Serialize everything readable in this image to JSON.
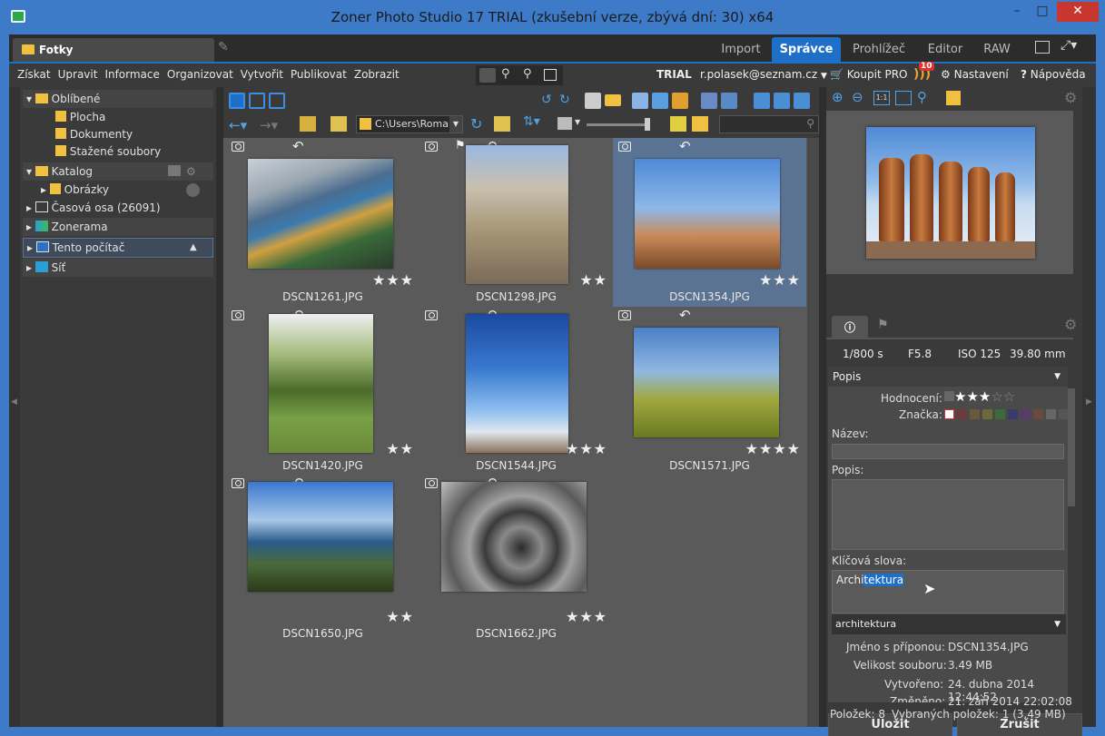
{
  "window": {
    "title": "Zoner Photo Studio 17 TRIAL (zkušební verze, zbývá dní: 30) x64",
    "minimize": "–",
    "maximize": "□",
    "close": "✕"
  },
  "tabs": {
    "left_tab": "Fotky",
    "import": "Import",
    "spravce": "Správce",
    "prohlizec": "Prohlížeč",
    "editor": "Editor",
    "raw": "RAW"
  },
  "menu": {
    "items": [
      "Získat",
      "Upravit",
      "Informace",
      "Organizovat",
      "Vytvořit",
      "Publikovat",
      "Zobrazit"
    ],
    "trial": "TRIAL",
    "email": "r.polasek@seznam.cz",
    "buy": "Koupit PRO",
    "badge": "10",
    "settings": "Nastavení",
    "help": "Nápověda"
  },
  "nav": {
    "path": "C:\\Users\\Roma",
    "search_placeholder": ""
  },
  "tree": {
    "oblibene": "Oblíbené",
    "plocha": "Plocha",
    "dokumenty": "Dokumenty",
    "stazene": "Stažené soubory",
    "katalog": "Katalog",
    "obrazky": "Obrázky",
    "casova_osa": "Časová osa (26091)",
    "zonerama": "Zonerama",
    "tento_pocitac": "Tento počítač",
    "sit": "Síť"
  },
  "photos": [
    {
      "name": "DSCN1261.JPG",
      "rating": 3,
      "theme": "mosaic",
      "max": 5
    },
    {
      "name": "DSCN1298.JPG",
      "rating": 2,
      "theme": "cathedral",
      "max": 5
    },
    {
      "name": "DSCN1354.JPG",
      "rating": 3,
      "theme": "chimneys",
      "max": 5
    },
    {
      "name": "DSCN1420.JPG",
      "rating": 2,
      "theme": "lake",
      "max": 5
    },
    {
      "name": "DSCN1544.JPG",
      "rating": 3,
      "theme": "tower",
      "max": 5
    },
    {
      "name": "DSCN1571.JPG",
      "rating": 4,
      "theme": "agave",
      "max": 5
    },
    {
      "name": "DSCN1650.JPG",
      "rating": 2,
      "theme": "harbor",
      "max": 5
    },
    {
      "name": "DSCN1662.JPG",
      "rating": 3,
      "theme": "spiral",
      "max": 5
    }
  ],
  "exif": {
    "shutter": "1/800 s",
    "aperture": "F5.8",
    "iso": "ISO 125",
    "focal": "39.80 mm"
  },
  "info": {
    "section": "Popis",
    "rating_label": "Hodnocení:",
    "rating_value": 3,
    "rating_max": 5,
    "mark_label": "Značka:",
    "name_label": "Název:",
    "name_value": "",
    "desc_label": "Popis:",
    "desc_value": "",
    "keywords_label": "Klíčová slova:",
    "keyword_typed": "Archi",
    "keyword_selected": "tektura",
    "suggestion": "architektura",
    "filename_label": "Jméno s příponou:",
    "filename": "DSCN1354.JPG",
    "size_label": "Velikost souboru:",
    "size": "3.49 MB",
    "created_label": "Vytvořeno:",
    "created": "24. dubna 2014 12:44:52",
    "modified_label": "Změněno:",
    "modified": "21. září 2014 22:02:08"
  },
  "actions": {
    "save": "Uložit",
    "cancel": "Zrušit"
  },
  "status": {
    "count": "Položek: 8",
    "selected": "Vybraných položek: 1 (3.49 MB)"
  },
  "colors": {
    "accent": "#1e6fc8",
    "selected_cell": "#5b7393",
    "bg_grid": "#5a5a5a",
    "panel": "#3a3a3a"
  }
}
